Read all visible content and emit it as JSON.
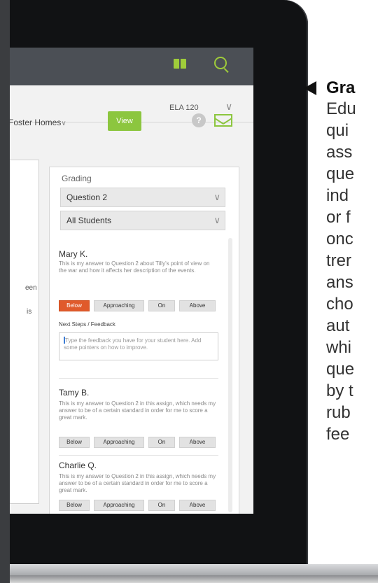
{
  "topbar": {
    "icons": [
      "book-icon",
      "search-icon"
    ]
  },
  "header": {
    "course": "ELA 120",
    "filter": "Foster Homes",
    "view_label": "View",
    "help_label": "?"
  },
  "left_fragments": [
    "een",
    "is"
  ],
  "grading": {
    "title": "Grading",
    "question_select": "Question 2",
    "students_select": "All Students",
    "next_steps_label": "Next Steps / Feedback",
    "feedback_placeholder": "Type the feedback you have for your student here. Add some pointers on how to improve.",
    "grade_options": [
      "Below",
      "Approaching",
      "On",
      "Above"
    ],
    "students": [
      {
        "name": "Mary K.",
        "answer": "This is my answer to Question 2 about Tilly's point of view on the war and how it affects her description of the events.",
        "selected": "Below"
      },
      {
        "name": "Tamy B.",
        "answer": "This is my answer to Question 2 in this assign, which needs my answer to be of a certain standard in order for me to score a great mark.",
        "selected": ""
      },
      {
        "name": "Charlie Q.",
        "answer": "This is my answer to Question 2 in this assign, which needs my answer to be of a certain standard in order for me to score a great mark.",
        "selected": ""
      }
    ]
  },
  "side": {
    "title": "Gra",
    "lines": [
      "Edu",
      "qui",
      "ass",
      "que",
      "ind",
      "or f",
      "onc",
      "trer",
      "ans",
      "cho",
      "aut",
      "whi",
      "que",
      "by t",
      "rub",
      "fee"
    ]
  },
  "colors": {
    "accent_green": "#8cc63f",
    "selected_orange": "#e05a2b",
    "topbar": "#4b4f55"
  }
}
